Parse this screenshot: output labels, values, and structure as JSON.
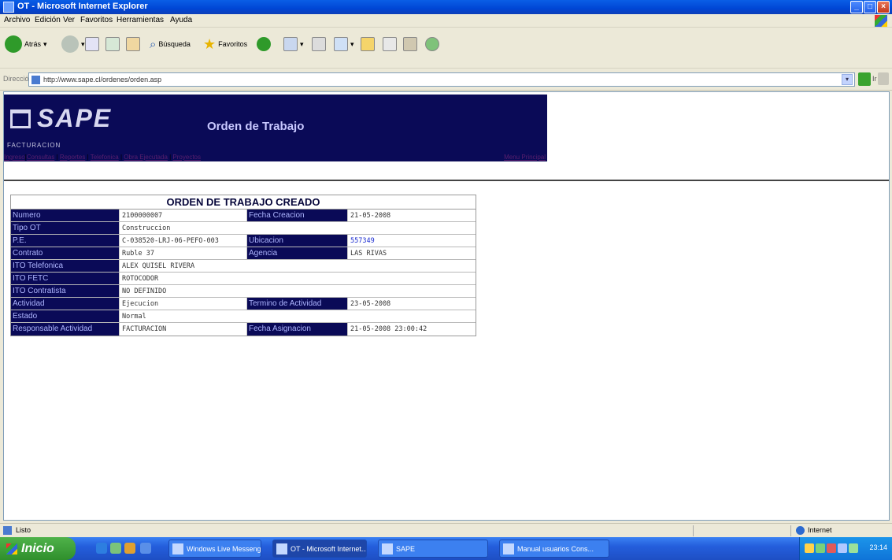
{
  "window": {
    "title": "OT - Microsoft Internet Explorer"
  },
  "menubar": [
    "Archivo",
    "Edición",
    "Ver",
    "Favoritos",
    "Herramientas",
    "Ayuda"
  ],
  "toolbar": {
    "back": "Atrás",
    "search": "Búsqueda",
    "favorites": "Favoritos"
  },
  "address": {
    "label": "Dirección",
    "url": "http://www.sape.cl/ordenes/orden.asp",
    "go": "Ir"
  },
  "page": {
    "logo": "SAPE",
    "logo_sub": "FACTURACION",
    "title": "Orden de Trabajo",
    "nav": [
      "Ingreso",
      "Consultas",
      "Reportes",
      "Telefonica",
      "Obra Ejecutada",
      "Proyectos"
    ],
    "menu_principal": "Menu Principal"
  },
  "ot": {
    "title": "ORDEN DE TRABAJO CREADO",
    "numero": {
      "label": "Numero",
      "value": "2100000007"
    },
    "fecha_creacion": {
      "label": "Fecha Creacion",
      "value": "21-05-2008"
    },
    "tipo_ot": {
      "label": "Tipo OT",
      "value": "Construccion"
    },
    "pe": {
      "label": "P.E.",
      "value": "C-038520-LRJ-06-PEFO-003"
    },
    "ubicacion": {
      "label": "Ubicacion",
      "value": "557349"
    },
    "contrato": {
      "label": "Contrato",
      "value": "Ruble 37"
    },
    "agencia": {
      "label": "Agencia",
      "value": "LAS RIVAS"
    },
    "ito_telefonica": {
      "label": "ITO Telefonica",
      "value": "ALEX QUISEL RIVERA"
    },
    "ito_fetc": {
      "label": "ITO FETC",
      "value": "ROTOCODOR"
    },
    "ito_contratista": {
      "label": "ITO Contratista",
      "value": "NO DEFINIDO"
    },
    "actividad": {
      "label": "Actividad",
      "value": "Ejecucion"
    },
    "termino_actividad": {
      "label": "Termino de Actividad",
      "value": "23-05-2008"
    },
    "estado": {
      "label": "Estado",
      "value": "Normal"
    },
    "responsable": {
      "label": "Responsable Actividad",
      "value": "FACTURACION"
    },
    "fecha_asignacion": {
      "label": "Fecha Asignacion",
      "value": "21-05-2008 23:00:42"
    }
  },
  "status": {
    "done": "Listo",
    "zone": "Internet"
  },
  "taskbar": {
    "start": "Inicio",
    "tasks": [
      "Windows Live Messenger",
      "OT - Microsoft Internet...",
      "SAPE",
      "Manual usuarios Cons..."
    ],
    "clock": "23:14"
  }
}
